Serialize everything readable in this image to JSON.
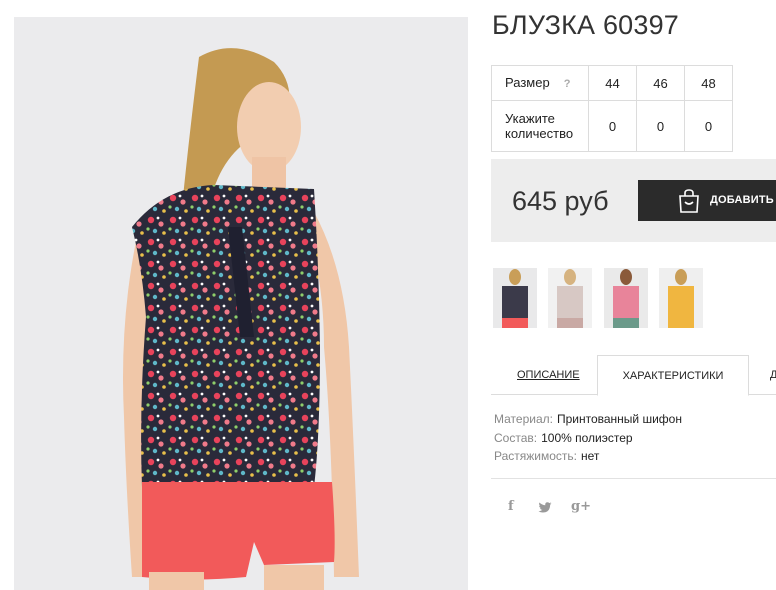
{
  "product": {
    "title": "БЛУЗКА 60397",
    "price": "645 руб",
    "add_to_cart_label": "ДОБАВИТЬ В КОРЗИНУ"
  },
  "size_table": {
    "size_label": "Размер",
    "help_label": "?",
    "sizes": [
      "44",
      "46",
      "48"
    ],
    "quantity_label": "Укажите количество",
    "quantities": [
      "0",
      "0",
      "0"
    ]
  },
  "thumbnails": [
    {
      "name": "thumb-dark-floral",
      "color": "#3b3a4a"
    },
    {
      "name": "thumb-pale-floral",
      "color": "#d7c8c4"
    },
    {
      "name": "thumb-pink-floral",
      "color": "#e8849a"
    },
    {
      "name": "thumb-yellow",
      "color": "#f0b640"
    }
  ],
  "tabs": [
    {
      "label": "ОПИСАНИЕ",
      "active": false
    },
    {
      "label": "ХАРАКТЕРИСТИКИ",
      "active": true
    },
    {
      "label": "Д",
      "active": false
    }
  ],
  "characteristics": [
    {
      "key": "Материал:",
      "value": "Принтованный шифон"
    },
    {
      "key": "Состав:",
      "value": "100% полиэстер"
    },
    {
      "key": "Растяжимость:",
      "value": "нет"
    }
  ],
  "social": {
    "facebook": "f",
    "twitter": "t",
    "google": "g+"
  },
  "colors": {
    "button_bg": "#2b2b2b",
    "price_box_bg": "#ededed",
    "photo_bg": "#ebebed",
    "shorts": "#f25a5a"
  },
  "icons": [
    "shopping-bag-icon",
    "facebook-icon",
    "twitter-icon",
    "google-plus-icon"
  ]
}
